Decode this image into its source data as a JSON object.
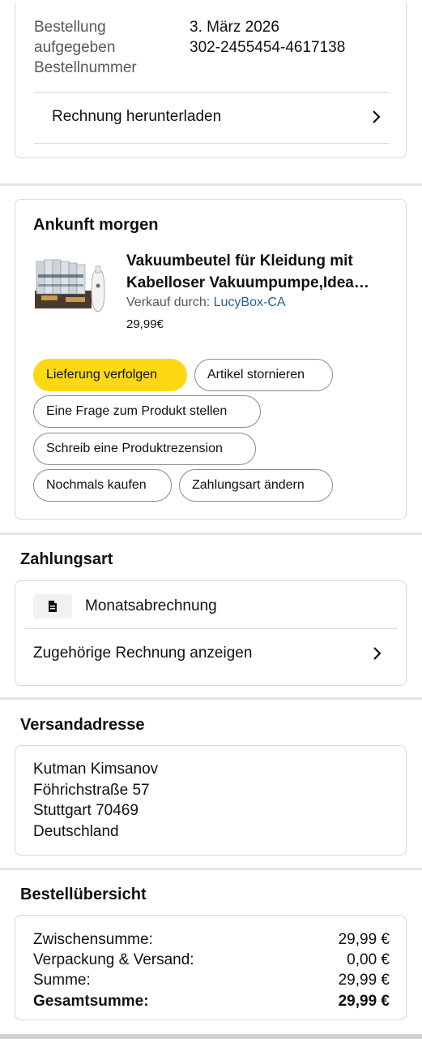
{
  "order_info": {
    "label_lines": [
      "Bestellung",
      "aufgegeben",
      "Bestellnummer"
    ],
    "value_lines": [
      "3. März 2026",
      "302-2455454-4617138"
    ],
    "invoice_link": "Rechnung herunterladen"
  },
  "delivery": {
    "heading": "Ankunft morgen",
    "product": {
      "title_line1": "Vakuumbeutel für Kleidung mit",
      "title_line2": "Kabelloser Vakuumpumpe,Idea…",
      "seller_prefix": "Verkauf durch:",
      "seller_name": "LucyBox-CA",
      "price": "29,99€",
      "image_icon": "vacuum-bags-product-image"
    },
    "actions": {
      "track": "Lieferung verfolgen",
      "cancel": "Artikel stornieren",
      "ask": "Eine Frage zum Produkt stellen",
      "review": "Schreib eine Produktrezension",
      "buy_again": "Nochmals kaufen",
      "change_payment": "Zahlungsart ändern"
    }
  },
  "payment": {
    "heading": "Zahlungsart",
    "method": "Monatsabrechnung",
    "method_icon": "document-icon",
    "invoice_link": "Zugehörige Rechnung anzeigen"
  },
  "shipping": {
    "heading": "Versandadresse",
    "lines": [
      "Kutman Kimsanov",
      "Föhrichstraße 57",
      "Stuttgart 70469",
      "Deutschland"
    ]
  },
  "summary": {
    "heading": "Bestellübersicht",
    "rows": [
      {
        "label": "Zwischensumme:",
        "value": "29,99 €"
      },
      {
        "label": "Verpackung & Versand:",
        "value": "0,00 €"
      },
      {
        "label": "Summe:",
        "value": "29,99 €"
      },
      {
        "label": "Gesamtsumme:",
        "value": "29,99 €"
      }
    ]
  },
  "colors": {
    "primary_button": "#ffd814",
    "link": "#2162a1",
    "border": "#d5d9d9"
  }
}
